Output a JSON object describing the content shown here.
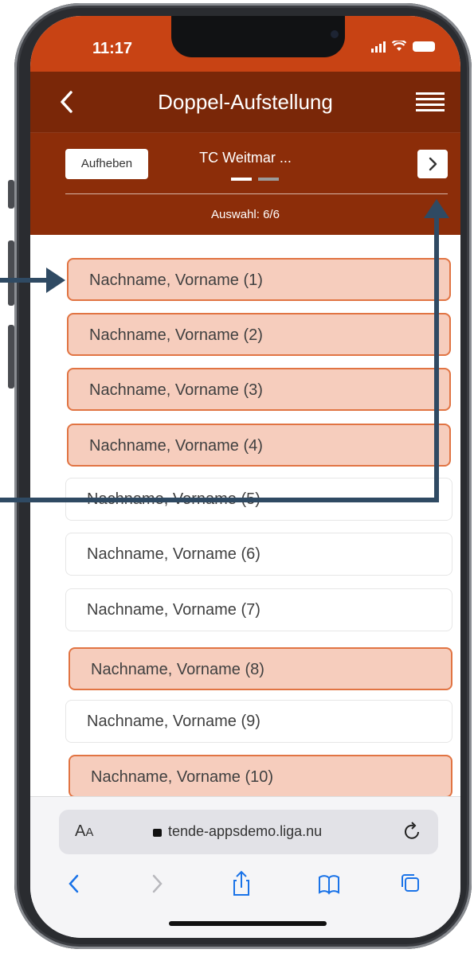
{
  "status": {
    "time": "11:17"
  },
  "header": {
    "title": "Doppel-Aufstellung"
  },
  "subbar": {
    "aufheben_label": "Aufheben",
    "team_name": "TC Weitmar ...",
    "selection": "Auswahl: 6/6",
    "pager": {
      "count": 2,
      "active": 1
    }
  },
  "players": [
    {
      "label": "Nachname, Vorname (1)",
      "selected": true
    },
    {
      "label": "Nachname, Vorname (2)",
      "selected": true
    },
    {
      "label": "Nachname, Vorname (3)",
      "selected": true
    },
    {
      "label": "Nachname, Vorname (4)",
      "selected": true
    },
    {
      "label": "Nachname, Vorname (5)",
      "selected": false
    },
    {
      "label": "Nachname, Vorname (6)",
      "selected": false
    },
    {
      "label": "Nachname, Vorname (7)",
      "selected": false
    },
    {
      "label": "Nachname, Vorname (8)",
      "selected": true
    },
    {
      "label": "Nachname, Vorname (9)",
      "selected": false
    },
    {
      "label": "Nachname, Vorname (10)",
      "selected": true
    }
  ],
  "browser": {
    "text_size_label_big": "A",
    "text_size_label_small": "A",
    "url": "tende-appsdemo.liga.nu"
  },
  "colors": {
    "status_bar": "#c84314",
    "header": "#7a2708",
    "subbar": "#8c2d09",
    "selected_fill": "#f6cdbd",
    "selected_border": "#e17443",
    "annotation_arrow": "#2f4a63"
  },
  "icons": {
    "back": "chevron-left-icon",
    "menu": "hamburger-menu-icon",
    "next": "chevron-right-icon",
    "lock": "lock-icon",
    "reload": "reload-icon",
    "share": "share-icon",
    "bookmarks": "book-icon",
    "tabs": "tabs-icon"
  }
}
